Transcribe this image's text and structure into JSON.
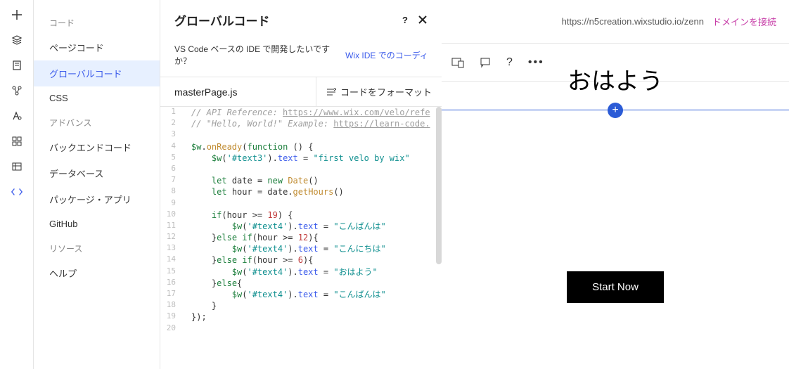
{
  "iconbar": {
    "items": [
      {
        "name": "add-icon"
      },
      {
        "name": "layers-icon"
      },
      {
        "name": "page-icon"
      },
      {
        "name": "connect-icon"
      },
      {
        "name": "text-icon"
      },
      {
        "name": "apps-icon"
      },
      {
        "name": "data-icon"
      },
      {
        "name": "code-icon"
      }
    ]
  },
  "sidebar": {
    "sections": [
      {
        "title": "コード",
        "items": [
          {
            "label": "ページコード"
          },
          {
            "label": "グローバルコード",
            "active": true
          },
          {
            "label": "CSS"
          }
        ]
      },
      {
        "title": "アドバンス",
        "items": [
          {
            "label": "バックエンドコード"
          },
          {
            "label": "データベース"
          },
          {
            "label": "パッケージ・アプリ"
          },
          {
            "label": "GitHub"
          }
        ]
      },
      {
        "title": "リソース",
        "items": [
          {
            "label": "ヘルプ"
          }
        ]
      }
    ]
  },
  "codepanel": {
    "title": "グローバルコード",
    "prompt": "VS Code ベースの IDE で開発したいですか？",
    "ide_link": "Wix IDE でのコーディ",
    "filename": "masterPage.js",
    "format_label": "コードをフォーマット"
  },
  "code_lines": [
    {
      "n": 1,
      "t": "comment",
      "text": "// API Reference: https://www.wix.com/velo/refe"
    },
    {
      "n": 2,
      "t": "comment",
      "text": "// \"Hello, World!\" Example: https://learn-code."
    },
    {
      "n": 3,
      "t": "blank",
      "text": ""
    },
    {
      "n": 4,
      "t": "code",
      "html": "<span class='tok-g'>$w</span><span class='tok-p'>.</span><span class='tok-f'>onReady</span><span class='tok-p'>(</span><span class='tok-k'>function</span><span class='tok-p'> () {</span>"
    },
    {
      "n": 5,
      "t": "code",
      "html": "    <span class='tok-g'>$w</span><span class='tok-p'>(</span><span class='tok-s'>'#text3'</span><span class='tok-p'>).</span><span class='tok-b'>text</span><span class='tok-p'> = </span><span class='tok-s'>\"first velo by wix\"</span>"
    },
    {
      "n": 6,
      "t": "blank",
      "text": ""
    },
    {
      "n": 7,
      "t": "code",
      "html": "    <span class='tok-k'>let</span><span class='tok-p'> date = </span><span class='tok-n'>new</span><span class='tok-p'> </span><span class='tok-f'>Date</span><span class='tok-p'>()</span>"
    },
    {
      "n": 8,
      "t": "code",
      "html": "    <span class='tok-k'>let</span><span class='tok-p'> hour = date.</span><span class='tok-f'>getHours</span><span class='tok-p'>()</span>"
    },
    {
      "n": 9,
      "t": "blank",
      "text": ""
    },
    {
      "n": 10,
      "t": "code",
      "html": "    <span class='tok-k'>if</span><span class='tok-p'>(hour &gt;= </span><span class='tok-num'>19</span><span class='tok-p'>) {</span>"
    },
    {
      "n": 11,
      "t": "code",
      "html": "        <span class='tok-g'>$w</span><span class='tok-p'>(</span><span class='tok-s'>'#text4'</span><span class='tok-p'>).</span><span class='tok-b'>text</span><span class='tok-p'> = </span><span class='tok-s'>\"こんばんは\"</span>"
    },
    {
      "n": 12,
      "t": "code",
      "html": "    <span class='tok-p'>}</span><span class='tok-k'>else if</span><span class='tok-p'>(hour &gt;= </span><span class='tok-num'>12</span><span class='tok-p'>){</span>"
    },
    {
      "n": 13,
      "t": "code",
      "html": "        <span class='tok-g'>$w</span><span class='tok-p'>(</span><span class='tok-s'>'#text4'</span><span class='tok-p'>).</span><span class='tok-b'>text</span><span class='tok-p'> = </span><span class='tok-s'>\"こんにちは\"</span>"
    },
    {
      "n": 14,
      "t": "code",
      "html": "    <span class='tok-p'>}</span><span class='tok-k'>else if</span><span class='tok-p'>(hour &gt;= </span><span class='tok-num'>6</span><span class='tok-p'>){</span>"
    },
    {
      "n": 15,
      "t": "code",
      "html": "        <span class='tok-g'>$w</span><span class='tok-p'>(</span><span class='tok-s'>'#text4'</span><span class='tok-p'>).</span><span class='tok-b'>text</span><span class='tok-p'> = </span><span class='tok-s'>\"おはよう\"</span>"
    },
    {
      "n": 16,
      "t": "code",
      "html": "    <span class='tok-p'>}</span><span class='tok-k'>else</span><span class='tok-p'>{</span>"
    },
    {
      "n": 17,
      "t": "code",
      "html": "        <span class='tok-g'>$w</span><span class='tok-p'>(</span><span class='tok-s'>'#text4'</span><span class='tok-p'>).</span><span class='tok-b'>text</span><span class='tok-p'> = </span><span class='tok-s'>\"こんばんは\"</span>"
    },
    {
      "n": 18,
      "t": "code",
      "html": "    <span class='tok-p'>}</span>"
    },
    {
      "n": 19,
      "t": "code",
      "html": "<span class='tok-p'>});</span>"
    },
    {
      "n": 20,
      "t": "blank",
      "text": ""
    }
  ],
  "preview": {
    "url": "https://n5creation.wixstudio.io/zenn",
    "connect_label": "ドメインを接続",
    "heading": "おはよう",
    "cta": "Start Now"
  }
}
